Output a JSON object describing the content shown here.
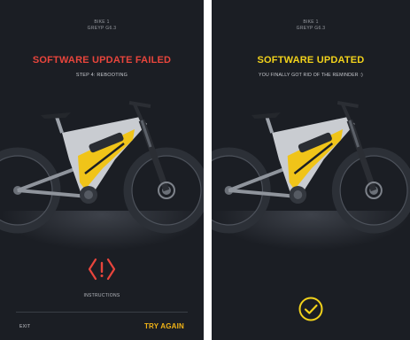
{
  "colors": {
    "background": "#1b1e24",
    "error_accent": "#e8453c",
    "success_accent": "#f2d21b",
    "action_accent": "#f2b416",
    "bike_frame": "#c9ccd1",
    "bike_graphic": "#f0c419"
  },
  "failed_screen": {
    "bike_name": "BIKE 1",
    "bike_id": "GREYP G6.3",
    "title": "SOFTWARE UPDATE FAILED",
    "status": "STEP 4: REBOOTING",
    "alert_icon": "warning-icon",
    "instructions_label": "INSTRUCTIONS",
    "exit_label": "EXIT",
    "retry_label": "TRY AGAIN"
  },
  "success_screen": {
    "bike_name": "BIKE 1",
    "bike_id": "GREYP G6.3",
    "title": "SOFTWARE UPDATED",
    "message": "YOU FINALLY GOT RID OF THE REMINDER :)",
    "done_icon": "check-circle-icon"
  }
}
